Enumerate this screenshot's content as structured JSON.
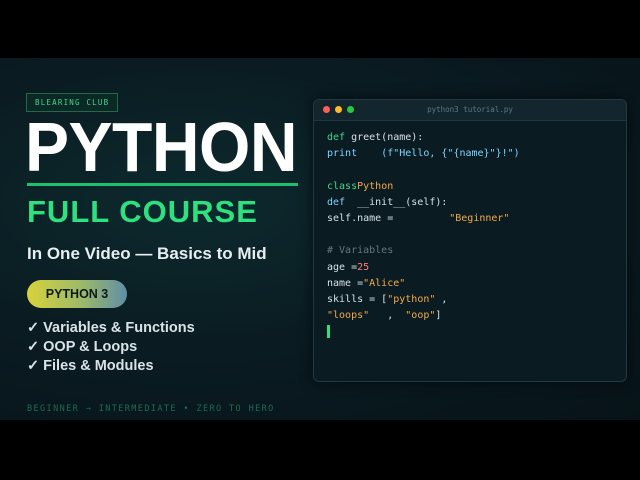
{
  "brand": "BLEARING CLUB",
  "title": "PYTHON",
  "subtitle": "FULL COURSE",
  "tagline": "In One Video — Basics to Mid",
  "badge": "PYTHON 3",
  "checkmark": "✓",
  "features": [
    "Variables & Functions",
    "OOP & Loops",
    "Files & Modules"
  ],
  "footer": "BEGINNER → INTERMEDIATE • ZERO TO HERO",
  "editor": {
    "filename": "python3 tutorial.py",
    "window_controls": [
      "close",
      "minimize",
      "maximize"
    ]
  },
  "code": {
    "l1_kw": "def",
    "l1_rest": " greet(name):",
    "l2_kw": "print",
    "l2_rest": "    (f\"Hello, {\"{name}\"}!\")",
    "l4_kw": "class",
    "l4_cls": "Python",
    "l5_kw": "def",
    "l5_rest": "  __init__(self):",
    "l6_rest": "self.name =",
    "l6_str": "\"Beginner\"",
    "l8_comment": "# Variables",
    "l9_rest": "age =",
    "l9_num": "25",
    "l10_rest": "name =",
    "l10_str": "\"Alice\"",
    "l11_rest": "skills = [",
    "l11_str": "\"python\"",
    "l11_end": " ,",
    "l12_str1": "\"loops\"",
    "l12_mid": "   ,  ",
    "l12_str2": "\"oop\"",
    "l12_end": "]"
  },
  "colors": {
    "accent_green": "#2ee07e",
    "keyword": "#3fd88a",
    "class_name": "#f5a94a",
    "string": "#7fd3ff",
    "number": "#ff7a7a",
    "comment": "#5f7a80"
  }
}
